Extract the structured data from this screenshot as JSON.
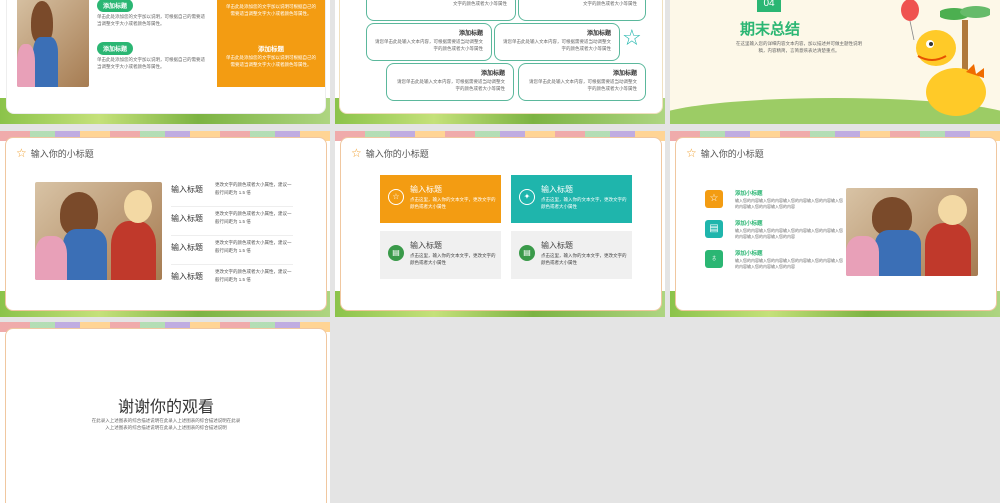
{
  "slide1": {
    "pill1": "添加标题",
    "pill2": "添加标题",
    "text1": "单击此处添加您的文字加以说明，可根据自己的需要适当调整文字大小或者颜色等属性。",
    "text2": "单击此处添加您的文字加以说明，可根据自己的需要适当调整文字大小或者颜色等属性。",
    "orange_text_top": "单击此处添加您的文字加以说明可根据自己的需要适当调整文字大小或者颜色等属性。",
    "orange_title": "添加标题",
    "orange_text": "单击此处添加您的文字加以说明可根据自己的需要适当调整文字大小或者颜色等属性。"
  },
  "slide2": {
    "boxes": [
      {
        "title": "",
        "desc": "文字的颜色或者大小等属性"
      },
      {
        "title": "",
        "desc": "文字的颜色或者大小等属性"
      },
      {
        "title": "添加标题",
        "desc": "请您单击此处输入文本内容，可根据需要适当动调整文字的颜色或者大小等属性"
      },
      {
        "title": "添加标题",
        "desc": "请您单击此处输入文本内容，可根据需要适当动调整文字的颜色或者大小等属性"
      },
      {
        "title": "添加标题",
        "desc": "请您单击此处输入文本内容，可根据需要适当动调整文字的颜色或者大小等属性"
      },
      {
        "title": "添加标题",
        "desc": "请您单击此处输入文本内容，可根据需要适当动调整文字的颜色或者大小等属性"
      }
    ]
  },
  "slide3": {
    "number": "04",
    "title": "期末总结",
    "desc": "在这里输入您的详细内容文本内容，加以描述并可做主题性说明稿，内容精简，言简意赅表达清楚重点。"
  },
  "slide4": {
    "subtitle": "输入你的小标题",
    "rows": [
      {
        "h": "输入标题",
        "d": "更改文字的颜色或者大小属性，建议一般行间距为 1.5 倍"
      },
      {
        "h": "输入标题",
        "d": "更改文字的颜色或者大小属性，建议一般行间距为 1.5 倍"
      },
      {
        "h": "输入标题",
        "d": "更改文字的颜色或者大小属性，建议一般行间距为 1.5 倍"
      },
      {
        "h": "输入标题",
        "d": "更改文字的颜色或者大小属性，建议一般行间距为 1.5 倍"
      }
    ]
  },
  "slide5": {
    "subtitle": "输入你的小标题",
    "tiles": [
      {
        "h": "输入标题",
        "d": "点击这里，输入你的文本文字，更改文字的颜色或者大小属性",
        "color": "#f39c12",
        "icon": "☆"
      },
      {
        "h": "输入标题",
        "d": "点击这里，输入你的文本文字，更改文字的颜色或者大小属性",
        "color": "#1fb5ac",
        "icon": "✦"
      },
      {
        "h": "输入标题",
        "d": "点击这里，输入你的文本文字，更改文字的颜色或者大小属性",
        "color": "#f0f0f0",
        "icon": "▤"
      },
      {
        "h": "输入标题",
        "d": "点击这里，输入你的文本文字，更改文字的颜色或者大小属性",
        "color": "#f0f0f0",
        "icon": "▤"
      }
    ]
  },
  "slide6": {
    "subtitle": "输入你的小标题",
    "items": [
      {
        "h": "添加小标题",
        "d": "输入您的内容输入您的内容输入您的内容输入您的内容输入您的内容输入您的内容输入您的内容",
        "icon": "☆"
      },
      {
        "h": "添加小标题",
        "d": "输入您的内容输入您的内容输入您的内容输入您的内容输入您的内容输入您的内容输入您的内容",
        "icon": "▤"
      },
      {
        "h": "添加小标题",
        "d": "输入您的内容输入您的内容输入您的内容输入您的内容输入您的内容输入您的内容输入您的内容",
        "icon": "♁"
      }
    ]
  },
  "slide7": {
    "title": "谢谢你的观看",
    "desc": "在此录入上述图表的综合描述说明在此录入上述图表的综合描述说明在此录入上述图表的综合描述说明在此录入上述图表的综合描述说明"
  }
}
